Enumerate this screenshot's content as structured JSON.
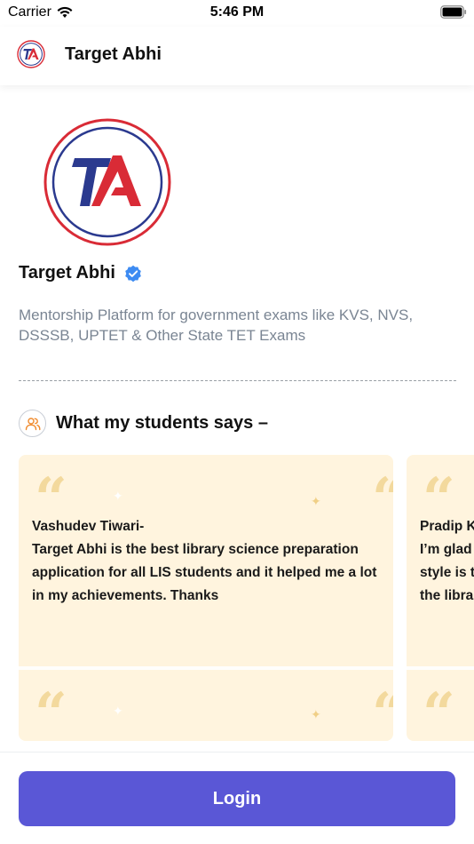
{
  "status_bar": {
    "carrier": "Carrier",
    "time": "5:46 PM",
    "wifi_icon": "wifi-icon",
    "battery_icon": "battery-icon"
  },
  "header": {
    "logo_icon": "target-abhi-logo",
    "title": "Target Abhi"
  },
  "profile": {
    "logo_icon": "target-abhi-logo",
    "name": "Target Abhi",
    "verified_icon": "verified-badge-icon",
    "description": "Mentorship Platform for government exams like KVS, NVS, DSSSB, UPTET & Other State TET Exams"
  },
  "testimonials": {
    "icon": "users-icon",
    "title": "What my students says –",
    "cards": [
      {
        "name": "Vashudev Tiwari-",
        "text": "Target Abhi is the best library science preparation application for all LIS students and it helped me a lot in my achievements. Thanks"
      },
      {
        "name": "Pradip K",
        "text_lines": [
          "I’m glad",
          "style is t",
          "the libra"
        ]
      }
    ]
  },
  "footer": {
    "login_label": "Login"
  },
  "colors": {
    "accent": "#5a57d6",
    "card_bg": "#fff4de",
    "verified": "#3d8bf2",
    "logo_red": "#d92b36",
    "logo_blue": "#2b3a8f",
    "muted_text": "#7a8593"
  }
}
